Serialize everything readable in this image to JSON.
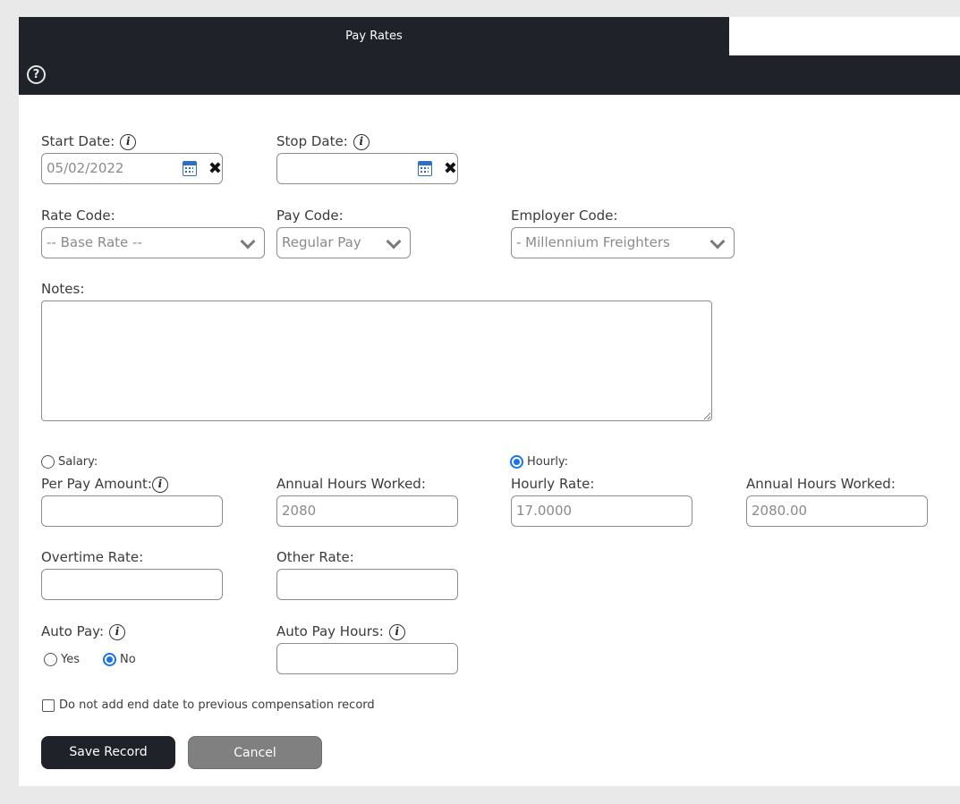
{
  "header": {
    "title": "Pay Rates"
  },
  "fields": {
    "start_date": {
      "label": "Start Date:",
      "value": "05/02/2022"
    },
    "stop_date": {
      "label": "Stop Date:",
      "value": ""
    },
    "rate_code": {
      "label": "Rate Code:",
      "value": "-- Base Rate --"
    },
    "pay_code": {
      "label": "Pay Code:",
      "value": "Regular Pay"
    },
    "employer_code": {
      "label": "Employer Code:",
      "value": "- Millennium Freighters"
    },
    "notes": {
      "label": "Notes:",
      "value": ""
    },
    "salary": {
      "label": "Salary:",
      "checked": false
    },
    "hourly": {
      "label": "Hourly:",
      "checked": true
    },
    "per_pay_amount": {
      "label": "Per Pay Amount:",
      "value": ""
    },
    "annual_hours_salary": {
      "label": "Annual Hours Worked:",
      "value": "2080"
    },
    "hourly_rate": {
      "label": "Hourly Rate:",
      "value": "17.0000"
    },
    "annual_hours_hourly": {
      "label": "Annual Hours Worked:",
      "value": "2080.00"
    },
    "overtime_rate": {
      "label": "Overtime Rate:",
      "value": ""
    },
    "other_rate": {
      "label": "Other Rate:",
      "value": ""
    },
    "auto_pay": {
      "label": "Auto Pay:",
      "yes_label": "Yes",
      "no_label": "No",
      "selected": "No"
    },
    "auto_pay_hours": {
      "label": "Auto Pay Hours:",
      "value": ""
    },
    "no_end_date": {
      "label": "Do not add end date to previous compensation record",
      "checked": false
    }
  },
  "buttons": {
    "save": "Save Record",
    "cancel": "Cancel"
  },
  "colors": {
    "header_bg": "#1f2228",
    "accent": "#1a73e8",
    "calendar_icon": "#2f6fc2",
    "cancel_bg": "#808080"
  }
}
